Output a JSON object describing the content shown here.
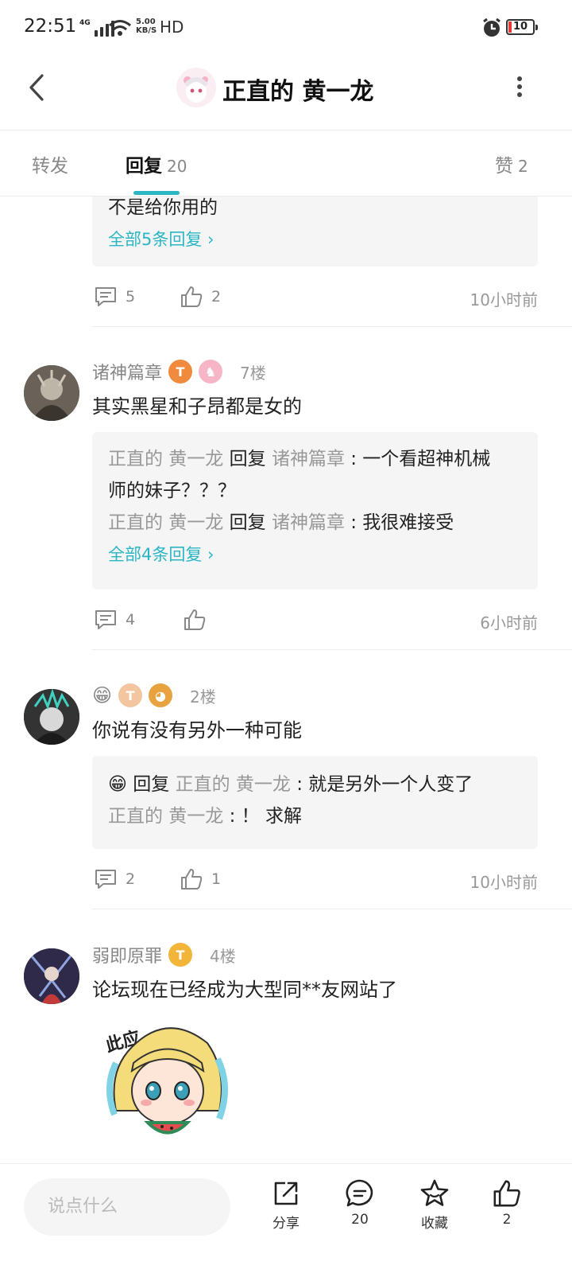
{
  "status_bar": {
    "time": "22:51",
    "network": "4G",
    "speed_value": "5.00",
    "speed_unit": "KB/S",
    "hd": "HD",
    "battery": "10"
  },
  "header": {
    "title": "正直的 黄一龙",
    "back_icon": "chevron-left-icon",
    "more_icon": "more-vertical-icon"
  },
  "tabs": {
    "forward": "转发",
    "reply": "回复",
    "reply_count": "20",
    "like": "赞",
    "like_count": "2"
  },
  "posts": [
    {
      "partial_reply_line": "不是给你用的",
      "all_link": "全部5条回复",
      "comment_count": "5",
      "like_count": "2",
      "time": "10小时前"
    },
    {
      "username": "诸神篇章",
      "floor": "7楼",
      "content": "其实黑星和子昂都是女的",
      "replies": [
        {
          "from": "正直的 黄一龙",
          "verb": "回复",
          "to": "诸神篇章",
          "text": ": 一个看超神机械",
          "text_cont": "师的妹子？？？"
        },
        {
          "from": "正直的 黄一龙",
          "verb": "回复",
          "to": "诸神篇章",
          "text": ": 我很难接受"
        }
      ],
      "all_link": "全部4条回复",
      "comment_count": "4",
      "like_count": "",
      "time": "6小时前"
    },
    {
      "username": "😁",
      "floor": "2楼",
      "content": "你说有没有另外一种可能",
      "replies": [
        {
          "from": "😁",
          "verb": "回复",
          "to": "正直的 黄一龙",
          "text": ": 就是另外一个人变了"
        },
        {
          "from": "正直的 黄一龙",
          "text": ": ！ 求解"
        }
      ],
      "comment_count": "2",
      "like_count": "1",
      "time": "10小时前"
    },
    {
      "username": "弱即原罪",
      "floor": "4楼",
      "content": "论坛现在已经成为大型同**友网站了",
      "sticker_text": "此应…"
    }
  ],
  "bottom_bar": {
    "placeholder": "说点什么",
    "share": "分享",
    "comments": "20",
    "favorite": "收藏",
    "likes": "2"
  },
  "colors": {
    "accent": "#2bb6c4",
    "muted": "#999999",
    "reply_bg": "#f5f5f5"
  }
}
